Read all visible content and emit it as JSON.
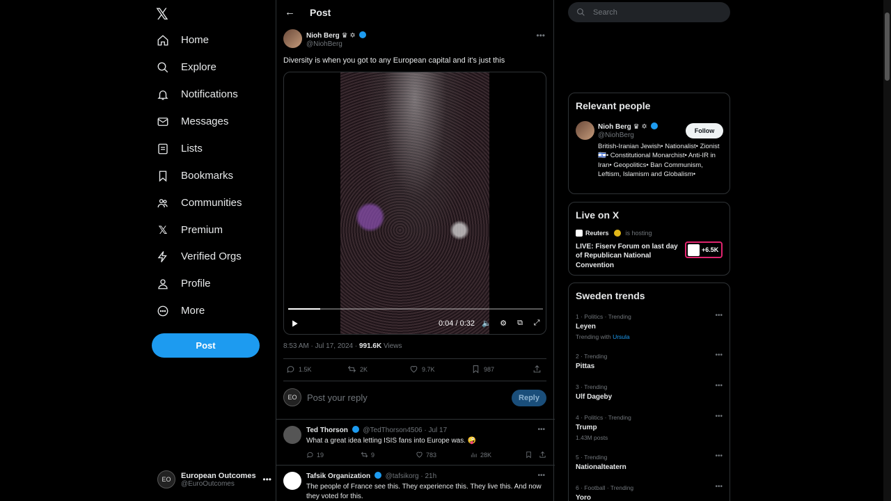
{
  "nav": {
    "items": [
      {
        "label": "Home",
        "icon": "home-icon"
      },
      {
        "label": "Explore",
        "icon": "search-icon"
      },
      {
        "label": "Notifications",
        "icon": "bell-icon"
      },
      {
        "label": "Messages",
        "icon": "mail-icon"
      },
      {
        "label": "Lists",
        "icon": "list-icon"
      },
      {
        "label": "Bookmarks",
        "icon": "bookmark-icon"
      },
      {
        "label": "Communities",
        "icon": "people-icon"
      },
      {
        "label": "Premium",
        "icon": "x-logo-icon"
      },
      {
        "label": "Verified Orgs",
        "icon": "lightning-icon"
      },
      {
        "label": "Profile",
        "icon": "person-icon"
      },
      {
        "label": "More",
        "icon": "more-circle-icon"
      }
    ],
    "post_label": "Post",
    "account": {
      "name": "European Outcomes",
      "handle": "@EuroOutcomes",
      "avatar_text": "EO"
    }
  },
  "header": {
    "title": "Post"
  },
  "post": {
    "author_name": "Nioh Berg",
    "author_handle": "@NiohBerg",
    "text": "Diversity is when you got to any European capital and it's just this",
    "video": {
      "time": "0:04 / 0:32",
      "progress": 0.125
    },
    "timestamp": "8:53 AM · Jul 17, 2024 · ",
    "views_count": "991.6K",
    "views_label": " Views",
    "stats": {
      "replies": "1.5K",
      "reposts": "2K",
      "likes": "9.7K",
      "bookmarks": "987"
    },
    "reply_placeholder": "Post your reply",
    "reply_button": "Reply",
    "reply_avatar_text": "EO"
  },
  "replies": [
    {
      "name": "Ted Thorson",
      "handle": "@TedThorson4506 · Jul 17",
      "text": "What a great idea letting ISIS fans into Europe was. 🤪",
      "replies": "19",
      "reposts": "9",
      "likes": "783",
      "views": "28K"
    },
    {
      "name": "Tafsik Organization",
      "handle": "@tafsikorg · 21h",
      "text": "The people of France see this.  They experience this.  They live this.  And now they voted for this."
    }
  ],
  "sidebar": {
    "search_placeholder": "Search",
    "relevant": {
      "title": "Relevant people",
      "name": "Nioh Berg",
      "handle": "@NiohBerg",
      "follow": "Follow",
      "bio": "British-Iranian Jewish• Nationalist• Zionist 🇮🇱• Constitutional Monarchist• Anti-IR in Iran• Geopolitics• Ban Communism, Leftism, Islamism and Globalism•"
    },
    "live": {
      "title": "Live on X",
      "host": "Reuters",
      "hosting": "is hosting",
      "event": "LIVE: Fiserv Forum on last day of Republican National Convention",
      "count": "+6.5K"
    },
    "trends": {
      "title": "Sweden trends",
      "items": [
        {
          "cat": "1 · Politics · Trending",
          "name": "Leyen",
          "sub_prefix": "Trending with ",
          "sub_link": "Ursula"
        },
        {
          "cat": "2 · Trending",
          "name": "Pittas"
        },
        {
          "cat": "3 · Trending",
          "name": "Ulf Dageby"
        },
        {
          "cat": "4 · Politics · Trending",
          "name": "Trump",
          "sub": "1.43M posts"
        },
        {
          "cat": "5 · Trending",
          "name": "Nationalteatern"
        },
        {
          "cat": "6 · Football · Trending",
          "name": "Yoro"
        }
      ]
    }
  },
  "colors": {
    "accent": "#1d9bf0",
    "live_border": "#e0246e",
    "background": "#000000"
  }
}
